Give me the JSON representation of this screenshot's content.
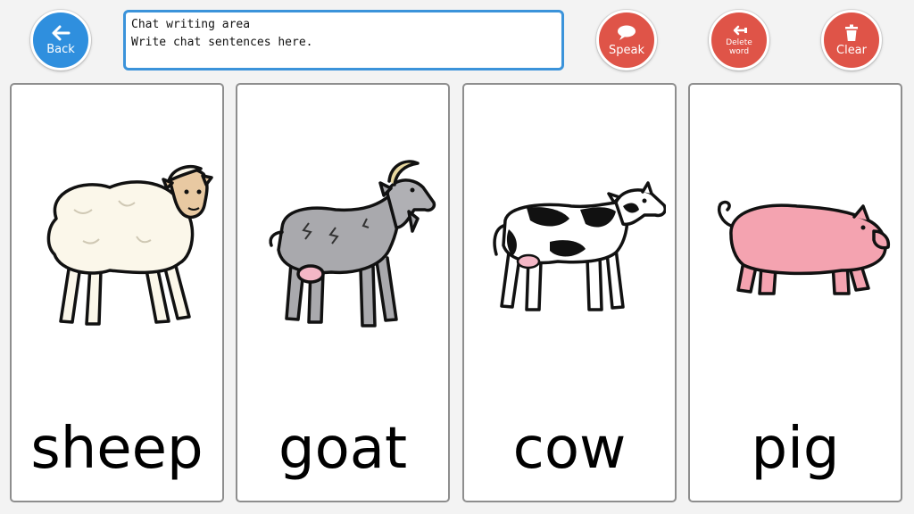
{
  "toolbar": {
    "back_label": "Back",
    "speak_label": "Speak",
    "delete_label_line1": "Delete",
    "delete_label_line2": "word",
    "clear_label": "Clear"
  },
  "chat": {
    "line1": "Chat writing area",
    "line2": "Write chat sentences here."
  },
  "cards": [
    {
      "word": "sheep",
      "icon": "sheep-icon"
    },
    {
      "word": "goat",
      "icon": "goat-icon"
    },
    {
      "word": "cow",
      "icon": "cow-icon"
    },
    {
      "word": "pig",
      "icon": "pig-icon"
    }
  ],
  "colors": {
    "back_button": "#2f8fde",
    "action_buttons": "#df5448",
    "chat_border": "#3b93da"
  }
}
